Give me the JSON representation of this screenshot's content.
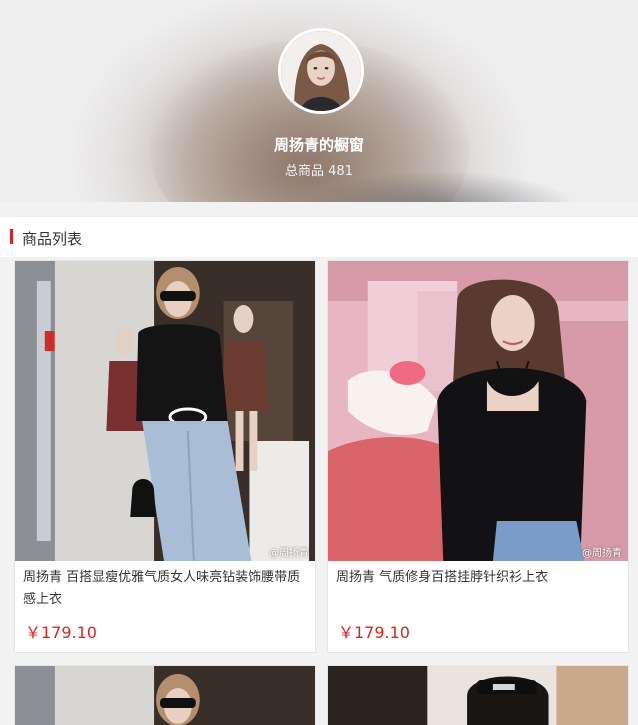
{
  "shop": {
    "name": "周扬青的橱窗",
    "count_label": "总商品 481"
  },
  "section": {
    "title": "商品列表"
  },
  "products": [
    {
      "title": "周扬青 百搭显瘦优雅气质女人味亮钻装饰腰带质感上衣",
      "price": "￥179.10",
      "watermark": "@周扬青"
    },
    {
      "title": "周扬青 气质修身百搭挂脖针织衫上衣",
      "price": "￥179.10",
      "watermark": "@周扬青"
    }
  ],
  "colors": {
    "accent": "#e01f1f",
    "background": "#f2f2f2"
  }
}
